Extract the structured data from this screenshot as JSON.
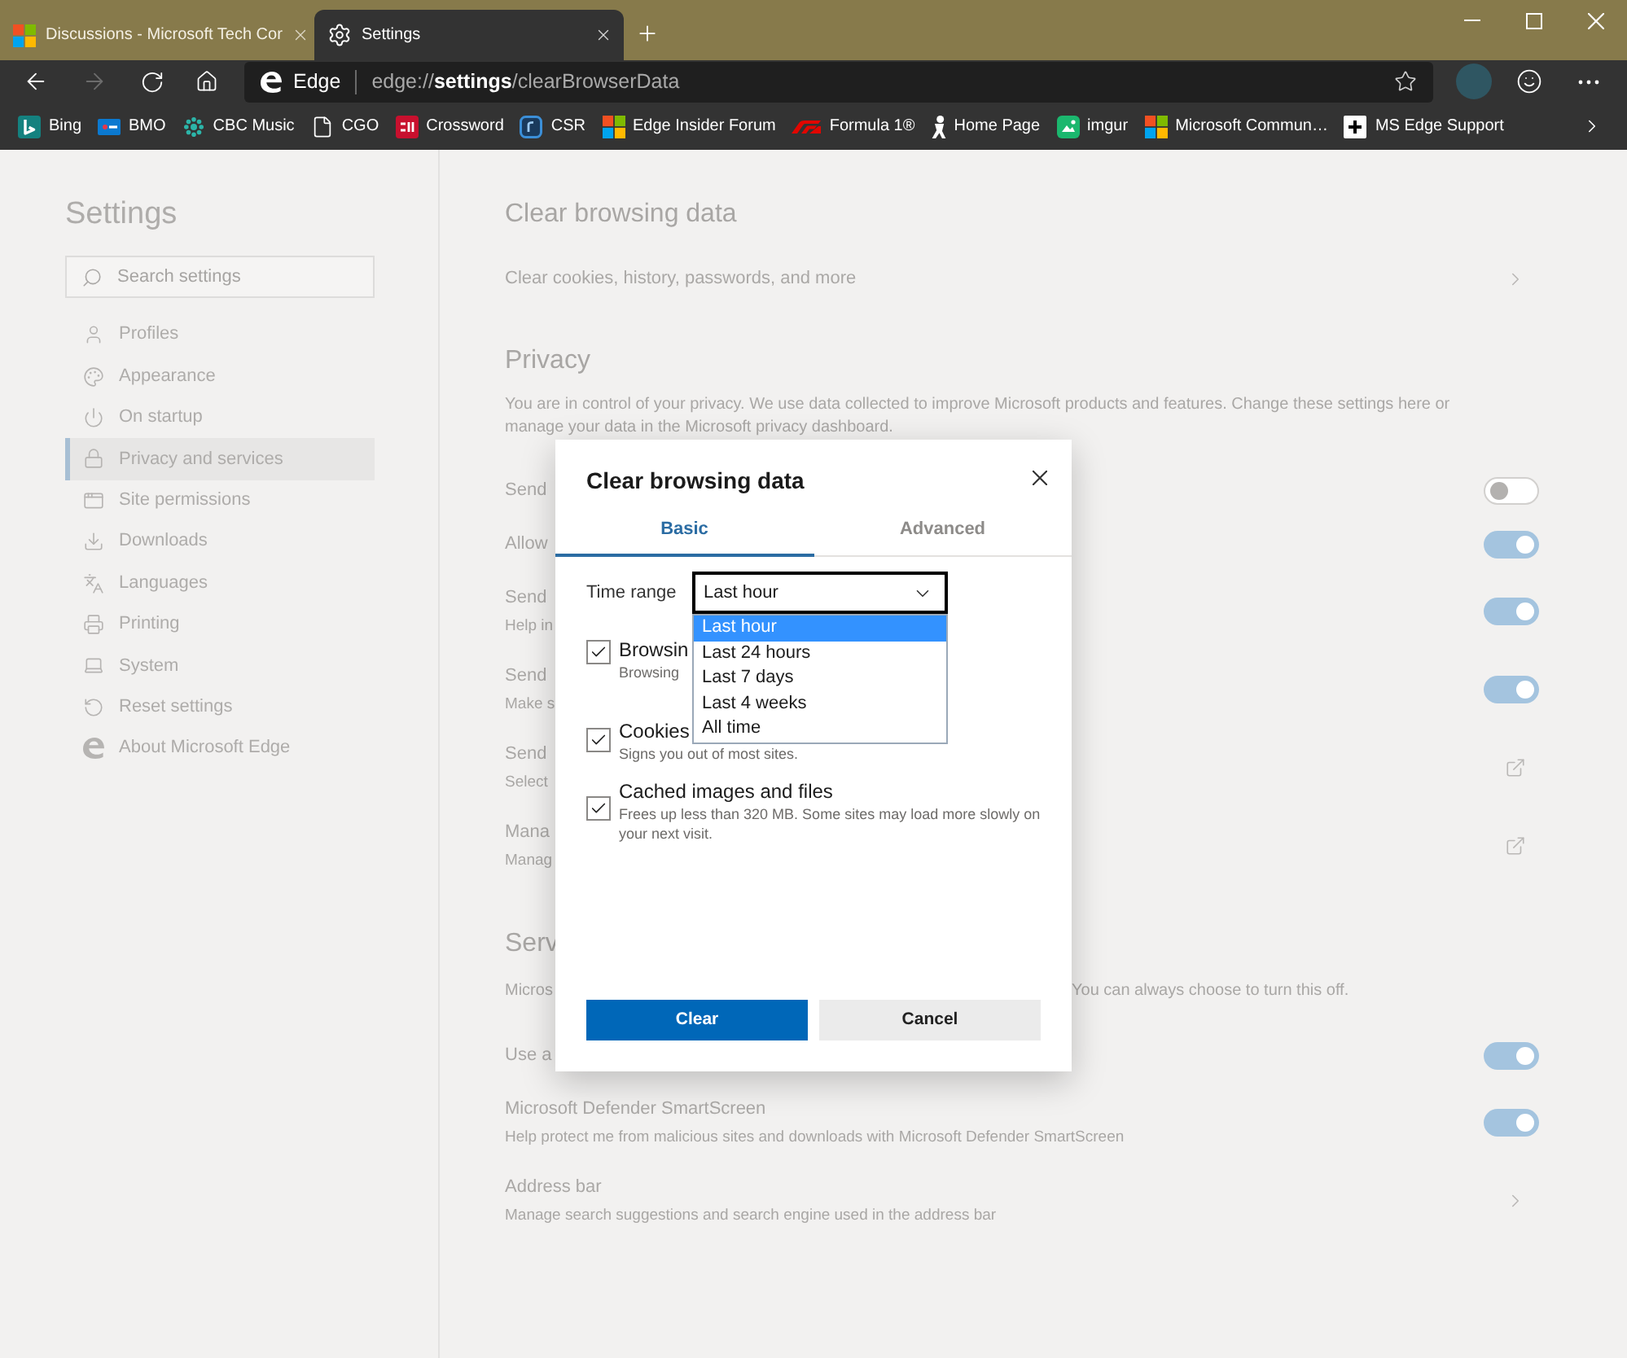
{
  "tabs": [
    {
      "title": "Discussions - Microsoft Tech Cor",
      "selected": false
    },
    {
      "title": "Settings",
      "selected": true
    }
  ],
  "toolbar": {
    "forward_disabled": true,
    "address_bar": {
      "site_label": "Edge",
      "url": "edge://**settings**/clearBrowserData"
    }
  },
  "bookmarks": [
    "Bing",
    "BMO",
    "CBC Music",
    "CGO",
    "Crossword",
    "CSR",
    "Edge Insider Forum",
    "Formula 1®",
    "Home Page",
    "imgur",
    "Microsoft Commun…",
    "MS Edge Support"
  ],
  "sidebar": {
    "title": "Settings",
    "search": {
      "placeholder": "Search settings"
    },
    "items": [
      {
        "label": "Profiles",
        "selected": false
      },
      {
        "label": "Appearance",
        "selected": false
      },
      {
        "label": "On startup",
        "selected": false
      },
      {
        "label": "Privacy and services",
        "selected": true
      },
      {
        "label": "Site permissions",
        "selected": false
      },
      {
        "label": "Downloads",
        "selected": false
      },
      {
        "label": "Languages",
        "selected": false
      },
      {
        "label": "Printing",
        "selected": false
      },
      {
        "label": "System",
        "selected": false
      },
      {
        "label": "Reset settings",
        "selected": false
      },
      {
        "label": "About Microsoft Edge",
        "selected": false
      }
    ]
  },
  "content": {
    "clear_browsing_data": {
      "heading": "Clear browsing data",
      "link": "Clear cookies, history, passwords, and more"
    },
    "privacy": {
      "heading": "Privacy",
      "description": "You are in control of your privacy. We use data collected to improve Microsoft products and features. Change these settings here or manage your data in the Microsoft privacy dashboard.",
      "rows": [
        {
          "kind": "toggle",
          "title": "Send",
          "on": false
        },
        {
          "kind": "toggle",
          "title": "Allow",
          "on": true
        },
        {
          "kind": "toggle",
          "title": "Send",
          "subtitle": "Help in",
          "on": true
        },
        {
          "kind": "toggle",
          "title": "Send",
          "subtitle": "Make s",
          "on": true
        },
        {
          "kind": "external",
          "title": "Send",
          "subtitle": "Select"
        },
        {
          "kind": "external",
          "title": "Mana",
          "subtitle": "Manag"
        }
      ]
    },
    "services": {
      "heading": "Serv",
      "description_start": "Micros",
      "description_end": "You can always choose to turn this off.",
      "rows": [
        {
          "kind": "toggle",
          "title": "Use a",
          "on": true
        },
        {
          "kind": "toggle",
          "title": "Microsoft Defender SmartScreen",
          "subtitle": "Help protect me from malicious sites and downloads with Microsoft Defender SmartScreen",
          "on": true
        },
        {
          "kind": "link",
          "title": "Address bar",
          "subtitle": "Manage search suggestions and search engine used in the address bar"
        }
      ]
    }
  },
  "dialog": {
    "title": "Clear browsing data",
    "tabs": [
      {
        "label": "Basic",
        "selected": true
      },
      {
        "label": "Advanced",
        "selected": false
      }
    ],
    "time_range": {
      "label": "Time range",
      "value": "Last hour",
      "expanded": true,
      "options": [
        {
          "label": "Last hour",
          "selected": true
        },
        {
          "label": "Last 24 hours",
          "selected": false
        },
        {
          "label": "Last 7 days",
          "selected": false
        },
        {
          "label": "Last 4 weeks",
          "selected": false
        },
        {
          "label": "All time",
          "selected": false
        }
      ]
    },
    "items": [
      {
        "title": "Browsin",
        "subtitle": "Browsing",
        "checked": true
      },
      {
        "title": "Cookies",
        "subtitle": "Signs you out of most sites.",
        "checked": true
      },
      {
        "title": "Cached images and files",
        "subtitle": "Frees up less than 320 MB. Some sites may load more slowly on your next visit.",
        "checked": true
      }
    ],
    "buttons": [
      {
        "label": "Clear",
        "kind": "primary"
      },
      {
        "label": "Cancel",
        "kind": "secondary"
      }
    ]
  }
}
